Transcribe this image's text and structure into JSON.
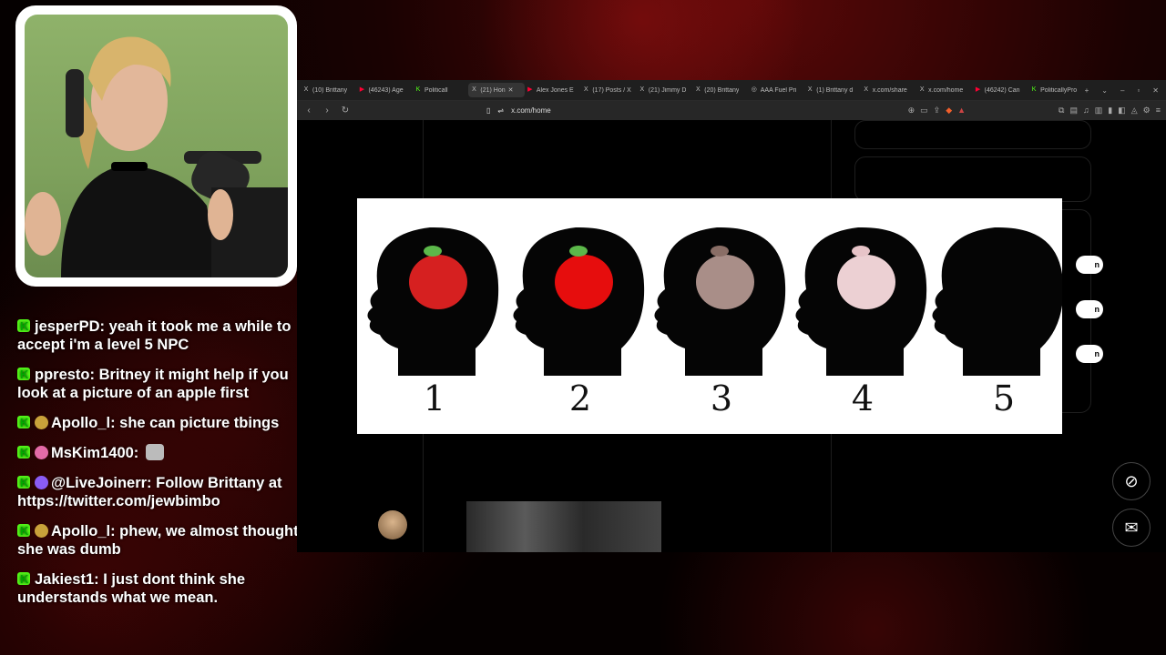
{
  "chat": [
    {
      "user": "jesperPD:",
      "text": " yeah it took me a while to accept i'm a level 5 NPC",
      "badge": ""
    },
    {
      "user": "ppresto:",
      "text": " Britney it might help if you look at a picture of an apple first",
      "badge": ""
    },
    {
      "user": "Apollo_l:",
      "text": " she can picture tbings",
      "badge": "gold"
    },
    {
      "user": "MsKim1400:",
      "text": " ",
      "badge": "pink",
      "emote": true
    },
    {
      "user": "@LiveJoinerr:",
      "text": " Follow Brittany at https://twitter.com/jewbimbo",
      "badge": "purple"
    },
    {
      "user": "Apollo_l:",
      "text": " phew, we almost thought she was dumb",
      "badge": "gold"
    },
    {
      "user": "Jakiest1:",
      "text": " I just dont think she understands what we mean.",
      "badge": ""
    }
  ],
  "browser": {
    "tabs": [
      {
        "icon": "X",
        "label": "(10) Brittany"
      },
      {
        "icon": "▶",
        "label": "(46243) Age"
      },
      {
        "icon": "K",
        "label": "Politicall"
      },
      {
        "icon": "X",
        "label": "(21) Hon",
        "active": true
      },
      {
        "icon": "▶",
        "label": "Alex Jones E"
      },
      {
        "icon": "X",
        "label": "(17) Posts / X"
      },
      {
        "icon": "X",
        "label": "(21) Jimmy D"
      },
      {
        "icon": "X",
        "label": "(20) Brittany"
      },
      {
        "icon": "◎",
        "label": "AAA Fuel Pri"
      },
      {
        "icon": "X",
        "label": "(1) Brittany d"
      },
      {
        "icon": "X",
        "label": "x.com/share"
      },
      {
        "icon": "X",
        "label": "x.com/home"
      },
      {
        "icon": "▶",
        "label": "(46242) Can"
      },
      {
        "icon": "K",
        "label": "PoliticallyPro"
      }
    ],
    "url": "x.com/home",
    "follow_label": "n"
  },
  "meme": {
    "numbers": [
      "1",
      "2",
      "3",
      "4",
      "5"
    ]
  },
  "colors": {
    "kick_green": "#53fc18",
    "accent_red": "#5a0808"
  }
}
